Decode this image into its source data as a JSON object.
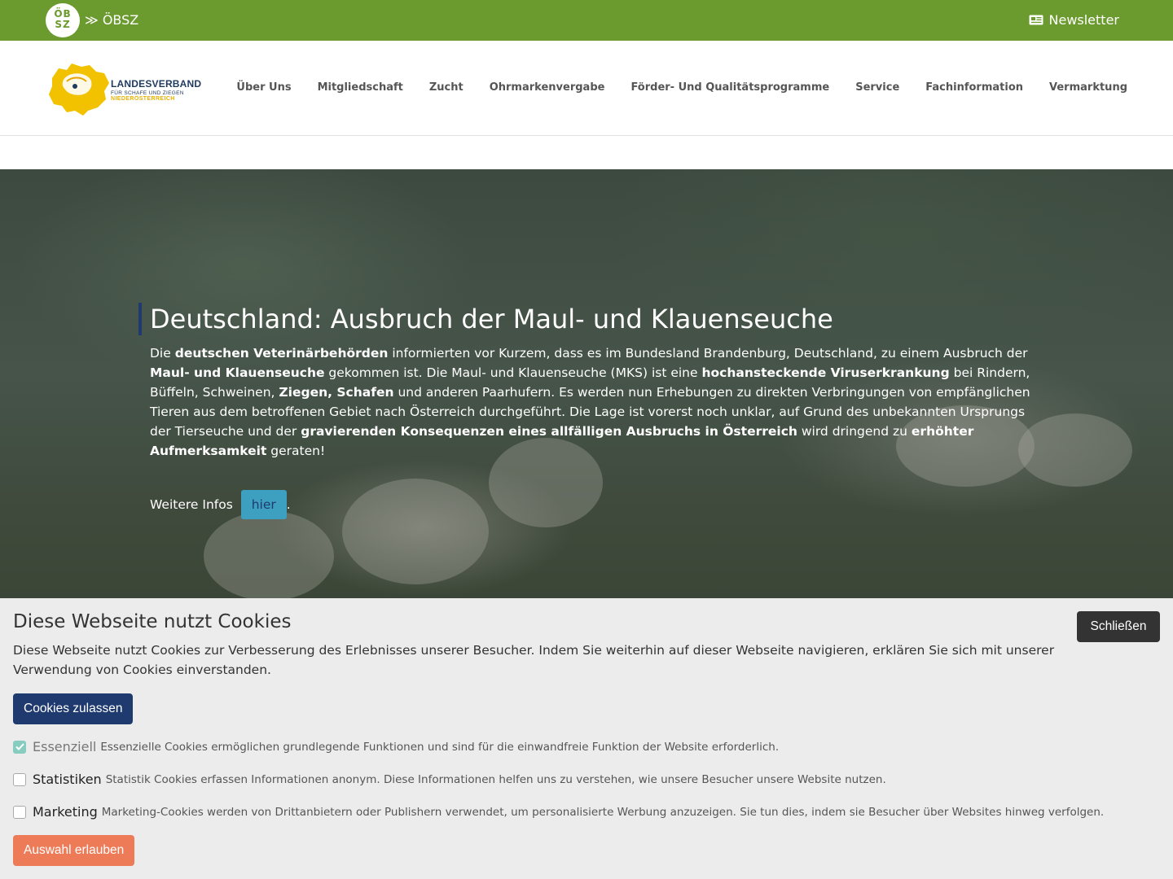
{
  "topbar": {
    "badge_line1": "ÖB",
    "badge_line2": "SZ",
    "crumb": "≫ ÖBSZ",
    "newsletter": "Newsletter"
  },
  "logo": {
    "line1": "LANDESVERBAND",
    "line2": "FÜR SCHAFE UND ZIEGEN",
    "line3": "NIEDERÖSTERREICH",
    "color_primary": "#1f3a5f",
    "color_accent": "#e8b100"
  },
  "nav": {
    "items": [
      {
        "label": "Über Uns"
      },
      {
        "label": "Mitgliedschaft"
      },
      {
        "label": "Zucht"
      },
      {
        "label": "Ohrmarkenvergabe"
      },
      {
        "label": "Förder- Und Qualitätsprogramme"
      },
      {
        "label": "Service"
      },
      {
        "label": "Fachinformation"
      },
      {
        "label": "Vermarktung"
      }
    ]
  },
  "hero": {
    "title": "Deutschland: Ausbruch der Maul- und Klauenseuche",
    "p": {
      "t1": "Die ",
      "b1": "deutschen Veterinärbehörden",
      "t2": " informierten vor Kurzem, dass es im Bundesland Brandenburg, Deutschland, zu einem Ausbruch der ",
      "b2": "Maul- und Klauenseuche",
      "t3": " gekommen ist. Die Maul- und Klauenseuche (MKS) ist eine ",
      "b3": "hochansteckende Viruserkrankung",
      "t4": " bei Rindern, Büffeln, Schweinen, ",
      "b4": "Ziegen, Schafen",
      "t5": " und anderen Paarhufern. Es werden nun Erhebungen zu direkten Verbringungen von empfänglichen Tieren aus dem betroffenen Gebiet nach Österreich durchgeführt. Die Lage ist vorerst noch unklar, auf Grund des unbekannten Ursprungs der Tierseuche und der ",
      "b5": "gravierenden Konsequenzen eines allfälligen Ausbruchs in Österreich",
      "t6": " wird dringend zu ",
      "b6": "erhöhter Aufmerksamkeit",
      "t7": " geraten!"
    },
    "more_text": "Weitere Infos ",
    "more_button": "hier",
    "more_suffix": "."
  },
  "cookie": {
    "title": "Diese Webseite nutzt Cookies",
    "close_button": "Schließen",
    "text": "Diese Webseite nutzt Cookies zur Verbesserung des Erlebnisses unserer Besucher. Indem Sie weiterhin auf dieser Webseite navigieren, erklären Sie sich mit unserer Verwendung von Cookies einverstanden.",
    "allow_button": "Cookies zulassen",
    "options": [
      {
        "label": "Essenziell",
        "desc": "Essenzielle Cookies ermöglichen grundlegende Funktionen und sind für die einwandfreie Funktion der Website erforderlich.",
        "checked": true
      },
      {
        "label": "Statistiken",
        "desc": "Statistik Cookies erfassen Informationen anonym. Diese Informationen helfen uns zu verstehen, wie unsere Besucher unsere Website nutzen.",
        "checked": false
      },
      {
        "label": "Marketing",
        "desc": "Marketing-Cookies werden von Drittanbietern oder Publishern verwendet, um personalisierte Werbung anzuzeigen. Sie tun dies, indem sie Besucher über Websites hinweg verfolgen.",
        "checked": false
      }
    ],
    "select_button": "Auswahl erlauben"
  },
  "colors": {
    "topbar": "#6b9a2e",
    "primary_button": "#1f3a6e",
    "hier_button": "#3ea0c0",
    "select_button": "#ee7b58",
    "close_button": "#333333"
  }
}
